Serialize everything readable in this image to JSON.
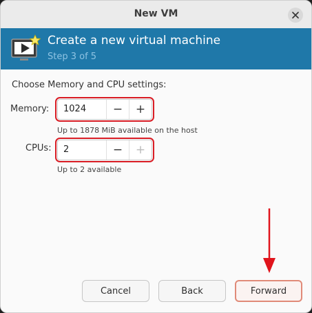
{
  "window": {
    "title": "New VM"
  },
  "banner": {
    "title": "Create a new virtual machine",
    "step": "Step 3 of 5"
  },
  "content": {
    "section_label": "Choose Memory and CPU settings:",
    "memory": {
      "label": "Memory:",
      "value": "1024",
      "decrement": "−",
      "increment": "+",
      "hint": "Up to 1878 MiB available on the host"
    },
    "cpus": {
      "label": "CPUs:",
      "value": "2",
      "decrement": "−",
      "increment": "+",
      "hint": "Up to 2 available"
    }
  },
  "buttons": {
    "cancel": "Cancel",
    "back": "Back",
    "forward": "Forward"
  },
  "colors": {
    "banner": "#1f78a9",
    "highlight": "#d91c24",
    "forward_border": "#e08a78"
  },
  "icons": {
    "close": "close-icon",
    "vm": "vm-screen-icon",
    "arrow": "arrow-down-icon"
  }
}
